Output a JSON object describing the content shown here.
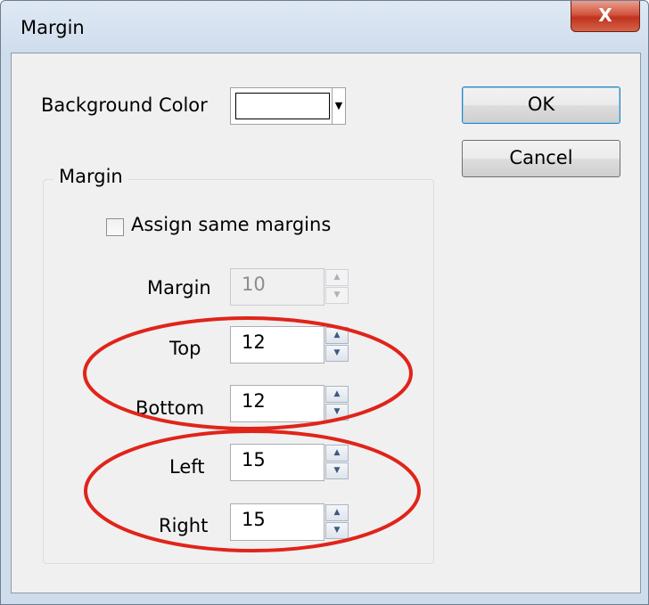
{
  "window": {
    "title": "Margin",
    "close_glyph": "X"
  },
  "background_color": {
    "label": "Background Color",
    "value_hex": "#ffffff",
    "dropdown_icon": "triangle-down"
  },
  "buttons": {
    "ok": "OK",
    "cancel": "Cancel"
  },
  "margin_group": {
    "title": "Margin",
    "same_margins": {
      "label": "Assign same margins",
      "checked": false
    },
    "fields": {
      "margin": {
        "label": "Margin",
        "value": "10",
        "enabled": false
      },
      "top": {
        "label": "Top",
        "value": "12"
      },
      "bottom": {
        "label": "Bottom",
        "value": "12"
      },
      "left": {
        "label": "Left",
        "value": "15"
      },
      "right": {
        "label": "Right",
        "value": "15"
      }
    }
  },
  "colors": {
    "annotation": "#e0241a",
    "default_button_border": "#3c7fb1",
    "close_button": "#c0321d"
  }
}
